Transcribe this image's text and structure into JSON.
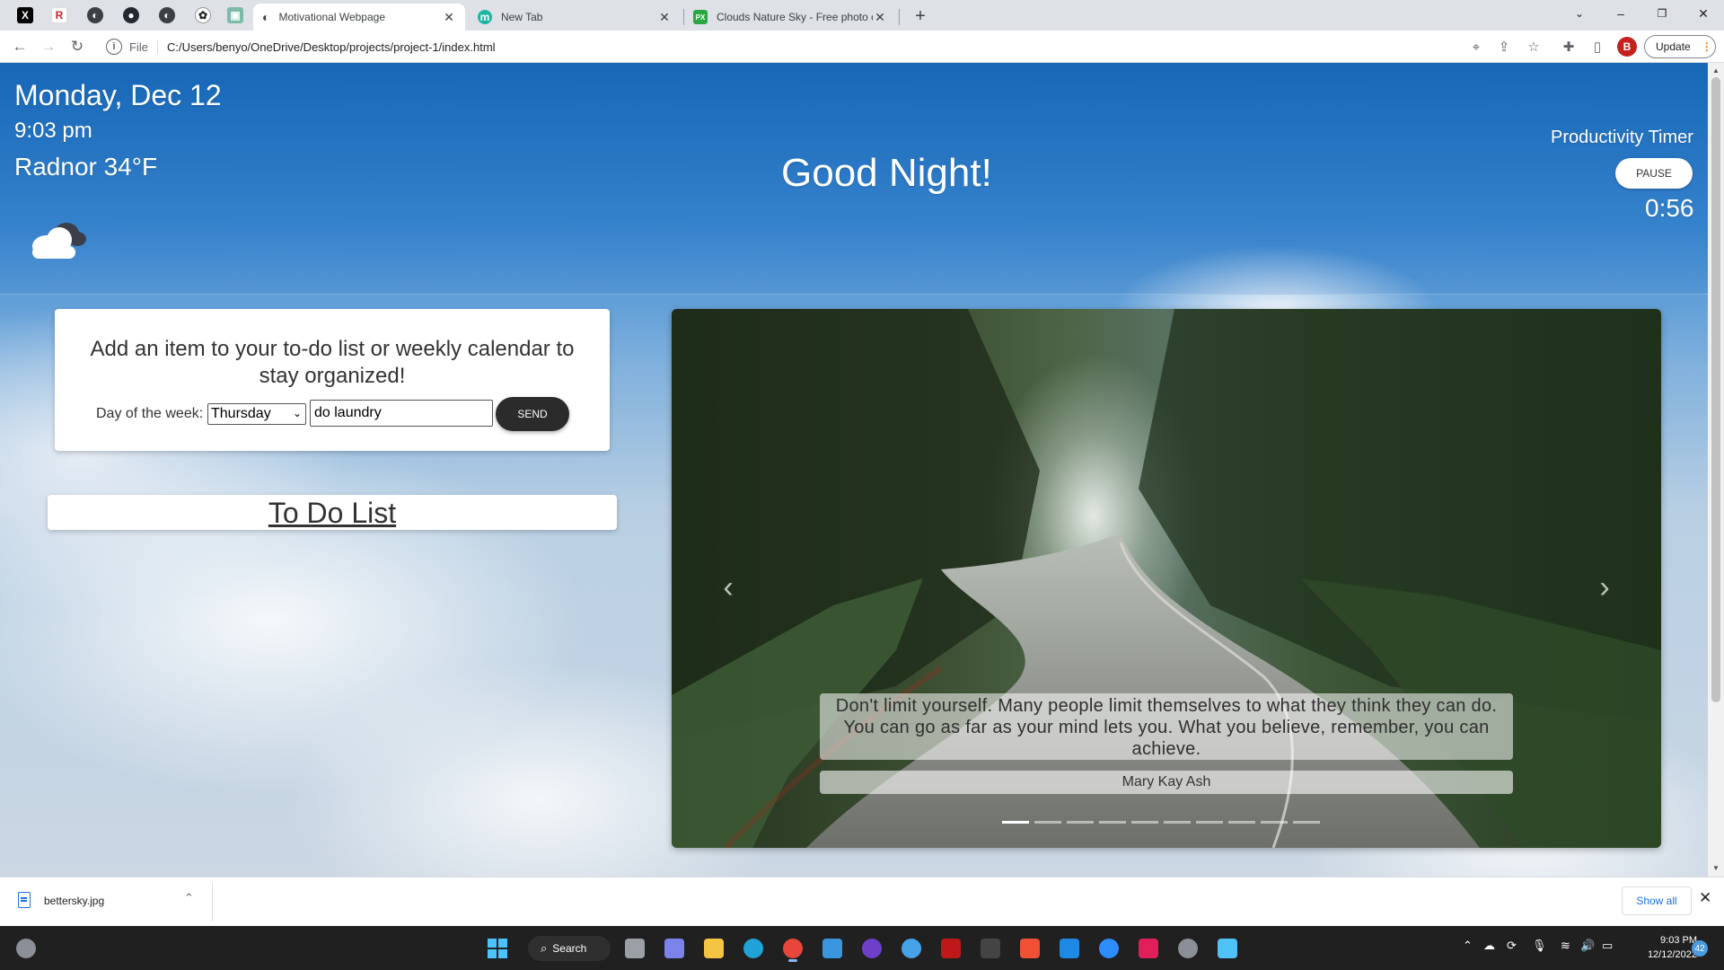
{
  "browser": {
    "pinned_tabs": [
      {
        "icon": "x-icon",
        "glyph": "X",
        "color": "#000000"
      },
      {
        "icon": "r-icon",
        "glyph": "R",
        "color": "#c62828"
      },
      {
        "icon": "globe-icon",
        "glyph": "◐",
        "color": "#3c4043"
      },
      {
        "icon": "github-icon",
        "glyph": "●",
        "color": "#24292f"
      },
      {
        "icon": "globe-icon",
        "glyph": "◐",
        "color": "#3c4043"
      },
      {
        "icon": "openai-icon",
        "glyph": "✿",
        "color": "#202124"
      },
      {
        "icon": "app-icon",
        "glyph": "▣",
        "color": "#7dbba6"
      }
    ],
    "tabs": [
      {
        "title": "Motivational Webpage",
        "active": true,
        "icon": "globe-icon"
      },
      {
        "title": "New Tab",
        "active": false,
        "icon": "m-icon",
        "glyph": "m"
      },
      {
        "title": "Clouds Nature Sky - Free photo o",
        "active": false,
        "icon": "px-icon",
        "glyph": "PX"
      }
    ],
    "address": {
      "scheme": "File",
      "url": "C:/Users/benyo/OneDrive/Desktop/projects/project-1/index.html"
    },
    "profile_initial": "B",
    "update_label": "Update",
    "window_controls": {
      "minimize": "–",
      "restore": "❐",
      "close": "✕"
    }
  },
  "page": {
    "date": "Monday, Dec 12",
    "time": "9:03 pm",
    "weather": "Radnor 34°F",
    "weather_icon": "cloudy-night-icon",
    "greeting": "Good Night!",
    "timer": {
      "title": "Productivity Timer",
      "button": "PAUSE",
      "value": "0:56"
    },
    "form": {
      "heading": "Add an item to your to-do list or weekly calendar to stay organized!",
      "day_label": "Day of the week:",
      "day_value": "Thursday",
      "task_value": "do laundry",
      "send_label": "SEND"
    },
    "todo_title": "To Do List",
    "carousel": {
      "quote": "Don't limit yourself. Many people limit themselves to what they think they can do. You can go as far as your mind lets you. What you believe, remember, you can achieve.",
      "author": "Mary Kay Ash",
      "slide_count": 10,
      "active_slide": 0
    }
  },
  "download_shelf": {
    "file": "bettersky.jpg",
    "show_all": "Show all"
  },
  "taskbar": {
    "search_label": "Search",
    "clock_time": "9:03 PM",
    "clock_date": "12/12/2022",
    "notification_count": "42",
    "apps": [
      {
        "name": "start",
        "color": "#4cc2ff"
      },
      {
        "name": "task-view",
        "color": "#9aa0a6"
      },
      {
        "name": "teams-chat",
        "color": "#7b83eb"
      },
      {
        "name": "file-explorer",
        "color": "#f4c542"
      },
      {
        "name": "edge",
        "color": "#1fa3d6"
      },
      {
        "name": "chrome",
        "color": "#e8453c"
      },
      {
        "name": "store",
        "color": "#3a96dd"
      },
      {
        "name": "github-desktop",
        "color": "#6e40c9"
      },
      {
        "name": "weather-app",
        "color": "#47a3e8"
      },
      {
        "name": "mcafee",
        "color": "#c01818"
      },
      {
        "name": "terminal",
        "color": "#444444"
      },
      {
        "name": "git",
        "color": "#f05033"
      },
      {
        "name": "vscode",
        "color": "#1e88e5"
      },
      {
        "name": "zoom",
        "color": "#2d8cff"
      },
      {
        "name": "slack",
        "color": "#e01e5a"
      },
      {
        "name": "settings",
        "color": "#8a8f98"
      },
      {
        "name": "notepad",
        "color": "#4fc3f7"
      }
    ]
  }
}
